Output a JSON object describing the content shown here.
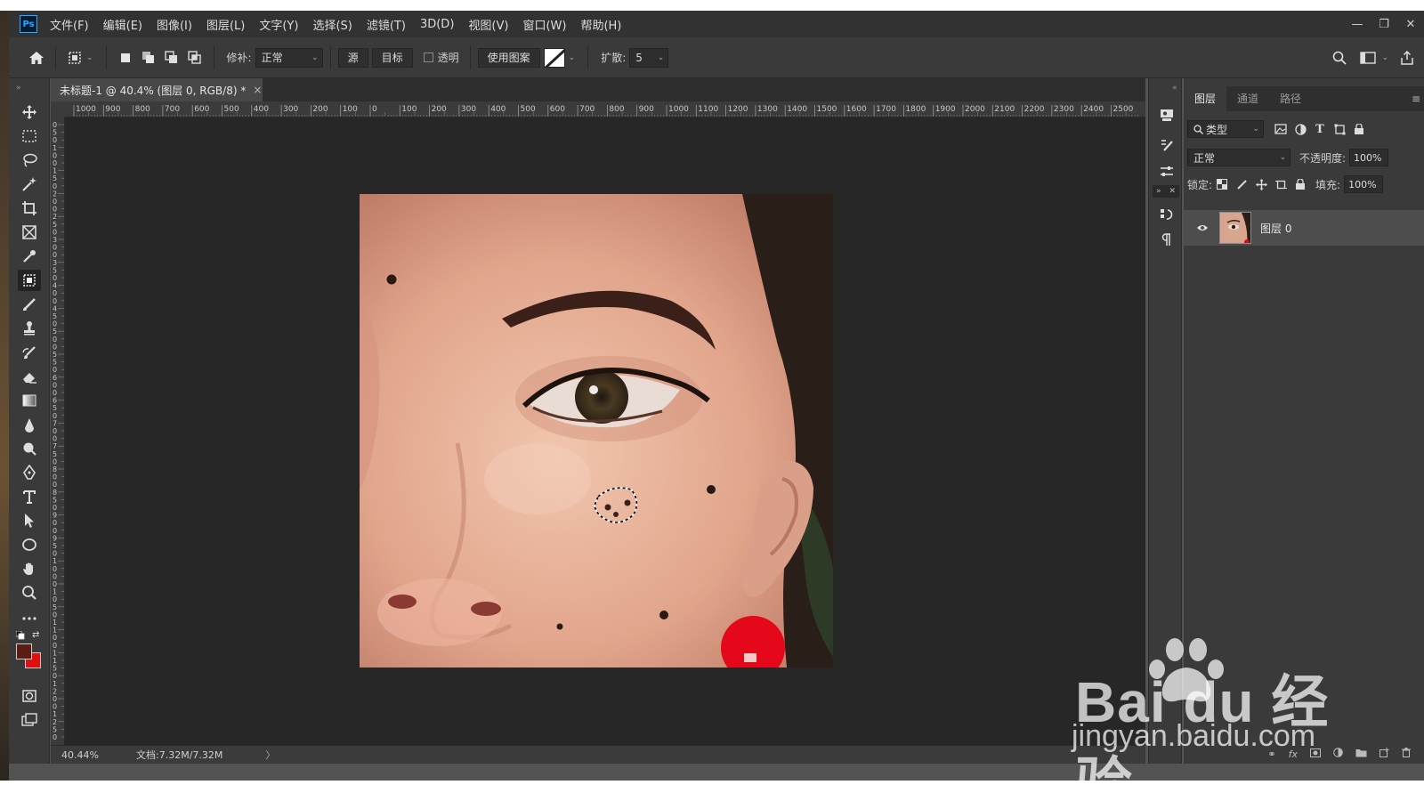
{
  "app": {
    "logo": "Ps",
    "menu": [
      "文件(F)",
      "编辑(E)",
      "图像(I)",
      "图层(L)",
      "文字(Y)",
      "选择(S)",
      "滤镜(T)",
      "3D(D)",
      "视图(V)",
      "窗口(W)",
      "帮助(H)"
    ],
    "window_controls": [
      "—",
      "❐",
      "✕"
    ]
  },
  "options": {
    "patch_label": "修补:",
    "patch_mode": "正常",
    "source_label": "源",
    "target_label": "目标",
    "transparent_label": "透明",
    "use_pattern_label": "使用图案",
    "diffusion_label": "扩散:",
    "diffusion_value": "5"
  },
  "document": {
    "tab_title": "未标题-1 @ 40.4% (图层 0, RGB/8) *",
    "close": "×",
    "zoom": "40.44%",
    "doc_size": "文档:7.32M/7.32M",
    "status_arrow": "〉"
  },
  "rulers": {
    "h_ticks": [
      "1000",
      "900",
      "800",
      "700",
      "600",
      "500",
      "400",
      "300",
      "200",
      "100",
      "0",
      "100",
      "200",
      "300",
      "400",
      "500",
      "600",
      "700",
      "800",
      "900",
      "1000",
      "1100",
      "1200",
      "1300",
      "1400",
      "1500",
      "1600",
      "1700",
      "1800",
      "1900",
      "2000",
      "2100",
      "2200",
      "2300",
      "2400",
      "2500"
    ],
    "v_ticks": [
      "0",
      "5",
      "0",
      "1",
      "0",
      "0",
      "1",
      "5",
      "0",
      "2",
      "0",
      "0",
      "2",
      "5",
      "0",
      "3",
      "0",
      "0",
      "3",
      "5",
      "0",
      "4",
      "0",
      "0",
      "4",
      "5",
      "0",
      "5",
      "0",
      "0",
      "5",
      "5",
      "0",
      "6",
      "0",
      "0",
      "6",
      "5",
      "0",
      "7",
      "0",
      "0",
      "7",
      "5",
      "0",
      "8",
      "0",
      "0",
      "8",
      "5",
      "0",
      "9",
      "0",
      "0",
      "9",
      "5",
      "0",
      "1",
      "0",
      "0",
      "0",
      "1",
      "0",
      "5",
      "0",
      "1",
      "1",
      "0",
      "0",
      "1",
      "1",
      "5",
      "0",
      "1",
      "2",
      "0",
      "0",
      "1",
      "2",
      "5",
      "0"
    ]
  },
  "panel": {
    "tabs": [
      "图层",
      "通道",
      "路径"
    ],
    "active_tab": "图层",
    "filter_kind": "类型",
    "blend_mode": "正常",
    "opacity_label": "不透明度:",
    "opacity_value": "100%",
    "lock_label": "锁定:",
    "fill_label": "填充:",
    "fill_value": "100%",
    "layers": [
      {
        "name": "图层 0",
        "visible": true,
        "selected": true
      }
    ]
  },
  "colors": {
    "foreground": "#5a1c14",
    "background": "#e01010",
    "accent": "#31a8ff"
  },
  "watermark": {
    "brand": "Bai du 经验",
    "url": "jingyan.baidu.com"
  }
}
